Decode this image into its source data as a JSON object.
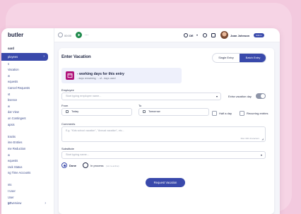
{
  "app": {
    "logo": "butler"
  },
  "sidebar": {
    "items": [
      {
        "label": "oard",
        "type": "head"
      },
      {
        "label": "ployees",
        "type": "active"
      },
      {
        "label": "s",
        "type": "item"
      },
      {
        "label": "Vacation",
        "type": "item"
      },
      {
        "label": "w",
        "type": "item"
      },
      {
        "label": "equests",
        "type": "item"
      },
      {
        "label": "Cancel Requests",
        "type": "item"
      },
      {
        "label": "st",
        "type": "item"
      },
      {
        "label": "bsence",
        "type": "item"
      },
      {
        "label": "w",
        "type": "item"
      },
      {
        "label": "dar View",
        "type": "item"
      },
      {
        "label": "on Contingent",
        "type": "item"
      },
      {
        "label": "apsis",
        "type": "item"
      },
      {
        "label": "",
        "type": "item"
      },
      {
        "label": "tracks",
        "type": "item"
      },
      {
        "label": "ime Entries",
        "type": "item"
      },
      {
        "label": "me Reduction",
        "type": "item"
      },
      {
        "label": "w",
        "type": "item"
      },
      {
        "label": "equests",
        "type": "item"
      },
      {
        "label": "rack Status",
        "type": "item"
      },
      {
        "label": "ng Time Accounts",
        "type": "item"
      },
      {
        "label": "",
        "type": "item"
      },
      {
        "label": "nts",
        "type": "item"
      },
      {
        "label": "t User",
        "type": "item"
      },
      {
        "label": "User",
        "type": "item"
      },
      {
        "label": "t Overview",
        "type": "item"
      }
    ],
    "footer": {
      "label": "ge"
    }
  },
  "topbar": {
    "timer": "00:00",
    "more": "···",
    "language": "DE",
    "user_name": "Joan Johnson",
    "role_badge": "Admin"
  },
  "form": {
    "title": "Enter Vacation",
    "segments": {
      "single": "Single Entry",
      "batch": "Batch Entry",
      "selected": "batch"
    },
    "summary": {
      "line1": "- working days for this entry",
      "line2": "- days remaining · - of - days used"
    },
    "employee": {
      "label": "Employee",
      "placeholder": "Start typing employee name..."
    },
    "extra_day": {
      "label": "Extra vacation day",
      "on": false
    },
    "from": {
      "label": "From",
      "value": "Today"
    },
    "to": {
      "label": "To",
      "value": "Tomorrow"
    },
    "half_day": {
      "label": "Half a day"
    },
    "recurring": {
      "label": "Recurring entries"
    },
    "comments": {
      "label": "Comments",
      "placeholder": "E.g. \"Kids school vacation\", \"Annual vacation\", etc...",
      "counter": "Max 300 characters"
    },
    "substitute": {
      "label": "Substitute",
      "placeholder": "Start typing name..."
    },
    "status": {
      "done": "Done",
      "in_process": "In process",
      "in_process_hint": "(not re-active)",
      "selected": "done"
    },
    "submit": "Request Vacation"
  },
  "colors": {
    "accent": "#3949ab",
    "brand_pink": "#b0127a",
    "page_bg": "#f3c9de"
  }
}
